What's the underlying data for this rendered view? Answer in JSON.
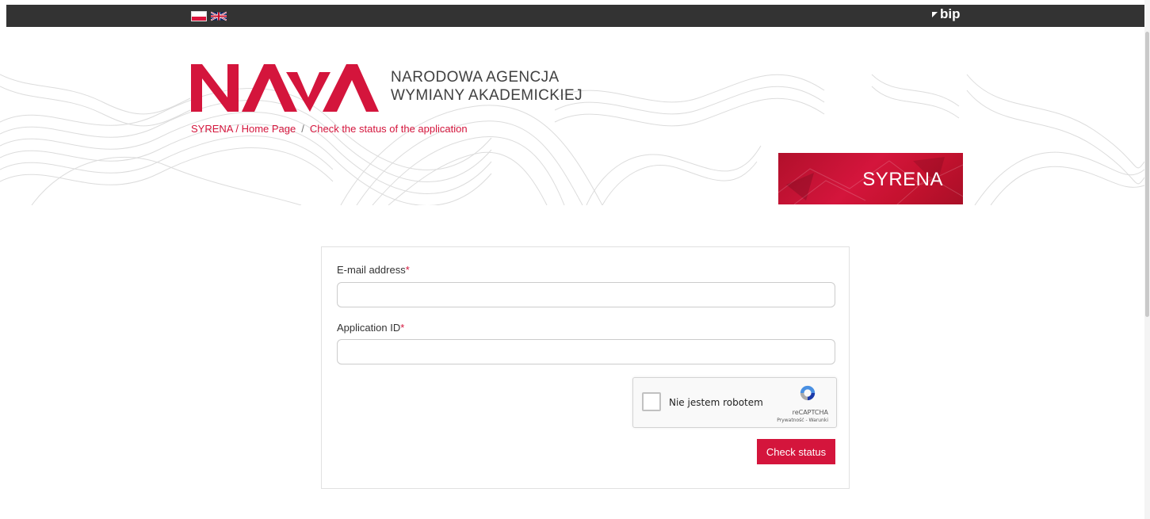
{
  "topbar": {
    "languages": [
      {
        "code": "pl",
        "name": "polish-flag-icon"
      },
      {
        "code": "en",
        "name": "uk-flag-icon"
      }
    ],
    "bip_label": "bip"
  },
  "header": {
    "logo_text": "NAWA",
    "agency_line1": "NARODOWA AGENCJA",
    "agency_line2": "WYMIANY AKADEMICKIEJ"
  },
  "breadcrumb": {
    "home": "SYRENA / Home Page",
    "separator": "/",
    "current": "Check the status of the application"
  },
  "banner": {
    "title": "SYRENA"
  },
  "form": {
    "email_label": "E-mail address",
    "email_value": "",
    "id_label": "Application ID",
    "id_value": "",
    "required_mark": "*",
    "recaptcha": {
      "checkbox_label": "Nie jestem robotem",
      "brand": "reCAPTCHA",
      "links": "Prywatność - Warunki"
    },
    "submit_label": "Check status"
  },
  "colors": {
    "accent": "#d4153c",
    "topbar": "#333333"
  }
}
